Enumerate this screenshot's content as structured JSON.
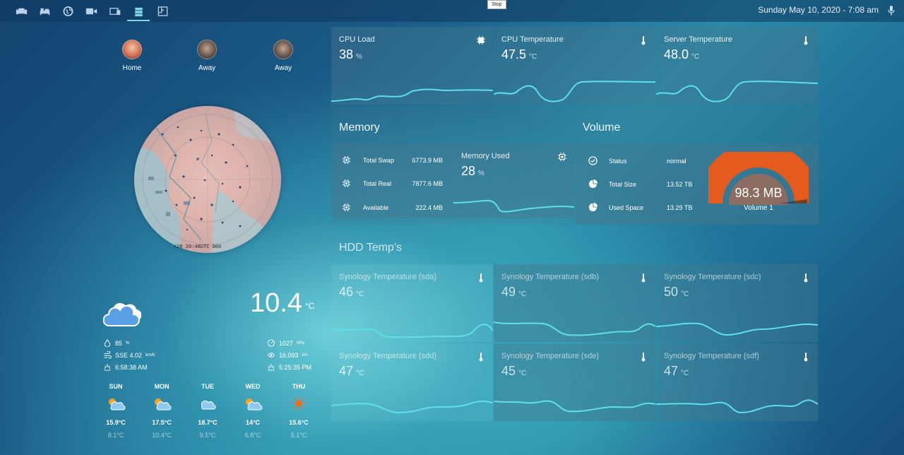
{
  "topbar": {
    "nav": [
      {
        "icon": "sofa-icon"
      },
      {
        "icon": "bed-icon"
      },
      {
        "icon": "globe-icon"
      },
      {
        "icon": "video-camera-icon"
      },
      {
        "icon": "devices-icon"
      },
      {
        "icon": "server-icon",
        "active": true
      },
      {
        "icon": "floorplan-icon"
      }
    ],
    "stop_label": "Stop",
    "datetime": "Sunday May 10, 2020 - 7:08 am",
    "accent": "#7fd8e6"
  },
  "people": [
    {
      "label": "Home"
    },
    {
      "label": "Away"
    },
    {
      "label": "Away"
    }
  ],
  "radar": {
    "timestamp": "/20 20:48UTC 000"
  },
  "weather": {
    "temperature": "10.4",
    "unit": "°C",
    "humidity": "85",
    "humidity_unit": "%",
    "wind": "SSE 4.02",
    "wind_unit": "km/h",
    "sunrise": "6:58:38 AM",
    "pressure": "1027",
    "pressure_unit": "hPa",
    "visibility": "16.093",
    "visibility_unit": "km",
    "sunset": "5:25:35 PM",
    "forecast": [
      {
        "day": "SUN",
        "hi": "15.9°C",
        "lo": "8.1°C",
        "icon": "partly-cloudy-icon"
      },
      {
        "day": "MON",
        "hi": "17.5°C",
        "lo": "10.4°C",
        "icon": "partly-cloudy-icon"
      },
      {
        "day": "TUE",
        "hi": "18.7°C",
        "lo": "9.5°C",
        "icon": "cloudy-icon"
      },
      {
        "day": "WED",
        "hi": "14°C",
        "lo": "6.8°C",
        "icon": "partly-cloudy-icon"
      },
      {
        "day": "THU",
        "hi": "15.6°C",
        "lo": "5.1°C",
        "icon": "sunny-icon"
      }
    ]
  },
  "stats": {
    "cpu_load": {
      "title": "CPU Load",
      "value": "38",
      "unit": "%",
      "icon": "cpu-icon"
    },
    "cpu_temp": {
      "title": "CPU Temperature",
      "value": "47.5",
      "unit": "°C",
      "icon": "thermometer-icon"
    },
    "server_temp": {
      "title": "Server Temperature",
      "value": "48.0",
      "unit": "°C",
      "icon": "thermometer-icon"
    }
  },
  "memory": {
    "section_title": "Memory",
    "rows": [
      {
        "label": "Total Swap",
        "value": "6773.9 MB"
      },
      {
        "label": "Total Real",
        "value": "7877.6 MB"
      },
      {
        "label": "Available",
        "value": "222.4 MB"
      }
    ],
    "used": {
      "title": "Memory Used",
      "value": "28",
      "unit": "%"
    }
  },
  "volume": {
    "section_title": "Volume",
    "rows": [
      {
        "label": "Status",
        "value": "normal",
        "icon": "check-circle-icon"
      },
      {
        "label": "Total Size",
        "value": "13.52 TB",
        "icon": "pie-chart-icon"
      },
      {
        "label": "Used Space",
        "value": "13.29 TB",
        "icon": "pie-chart-icon"
      }
    ],
    "gauge": {
      "value": "98.3 MB",
      "label": "Volume 1",
      "fill_fraction": 0.983,
      "color": "#e65a1e"
    }
  },
  "hdd": {
    "section_title": "HDD Temp's",
    "sensors": [
      {
        "title": "Synology Temperature (sda)",
        "value": "46",
        "unit": "°C"
      },
      {
        "title": "Synology Temperature (sdb)",
        "value": "49",
        "unit": "°C"
      },
      {
        "title": "Synology Temperature (sdc)",
        "value": "50",
        "unit": "°C"
      },
      {
        "title": "Synology Temperature (sdd)",
        "value": "47",
        "unit": "°C"
      },
      {
        "title": "Synology Temperature (sde)",
        "value": "45",
        "unit": "°C"
      },
      {
        "title": "Synology Temperature (sdf)",
        "value": "47",
        "unit": "°C"
      }
    ]
  }
}
